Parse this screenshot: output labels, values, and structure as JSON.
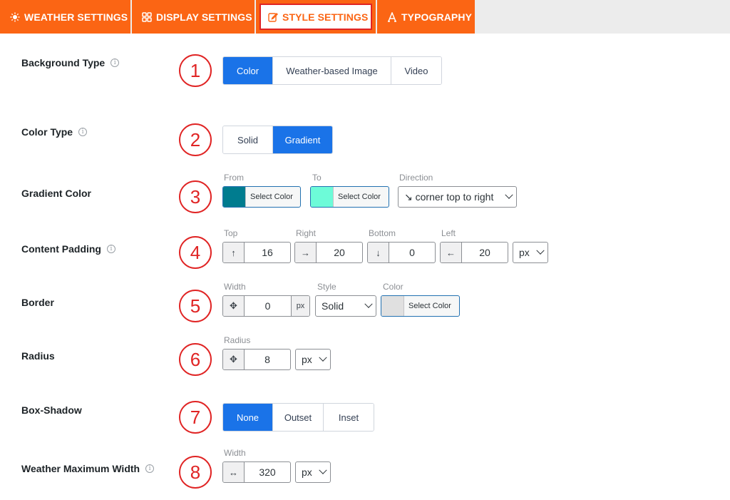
{
  "tabs": [
    {
      "label": "WEATHER SETTINGS",
      "icon": "weather-icon"
    },
    {
      "label": "DISPLAY SETTINGS",
      "icon": "grid-icon"
    },
    {
      "label": "STYLE SETTINGS",
      "icon": "edit-icon",
      "active": true
    },
    {
      "label": "TYPOGRAPHY",
      "icon": "typography-icon"
    }
  ],
  "colors": {
    "accent": "#fb6514",
    "highlight": "#e02424",
    "selected": "#1a73e8",
    "from_color": "#007c8f",
    "to_color": "#6dfbd8",
    "border_color": "#e0e0e0"
  },
  "rows": {
    "background_type": {
      "label": "Background Type",
      "number": "1",
      "options": [
        "Color",
        "Weather-based Image",
        "Video"
      ],
      "selected": "Color"
    },
    "color_type": {
      "label": "Color Type",
      "number": "2",
      "options": [
        "Solid",
        "Gradient"
      ],
      "selected": "Gradient"
    },
    "gradient_color": {
      "label": "Gradient Color",
      "number": "3",
      "from_label": "From",
      "to_label": "To",
      "direction_label": "Direction",
      "from_button": "Select Color",
      "to_button": "Select Color",
      "direction_value": "↘ corner top to right"
    },
    "content_padding": {
      "label": "Content Padding",
      "number": "4",
      "top_label": "Top",
      "right_label": "Right",
      "bottom_label": "Bottom",
      "left_label": "Left",
      "top": "16",
      "right": "20",
      "bottom": "0",
      "left": "20",
      "unit": "px",
      "top_icon": "↑",
      "right_icon": "→",
      "bottom_icon": "↓",
      "left_icon": "←"
    },
    "border": {
      "label": "Border",
      "number": "5",
      "width_label": "Width",
      "style_label": "Style",
      "color_label": "Color",
      "width": "0",
      "width_unit": "px",
      "style": "Solid",
      "color_button": "Select Color",
      "width_icon": "✥"
    },
    "radius": {
      "label": "Radius",
      "number": "6",
      "radius_label": "Radius",
      "value": "8",
      "unit": "px",
      "icon": "✥"
    },
    "box_shadow": {
      "label": "Box-Shadow",
      "number": "7",
      "options": [
        "None",
        "Outset",
        "Inset"
      ],
      "selected": "None"
    },
    "max_width": {
      "label": "Weather Maximum Width",
      "number": "8",
      "width_label": "Width",
      "value": "320",
      "unit": "px",
      "icon": "↔"
    }
  }
}
